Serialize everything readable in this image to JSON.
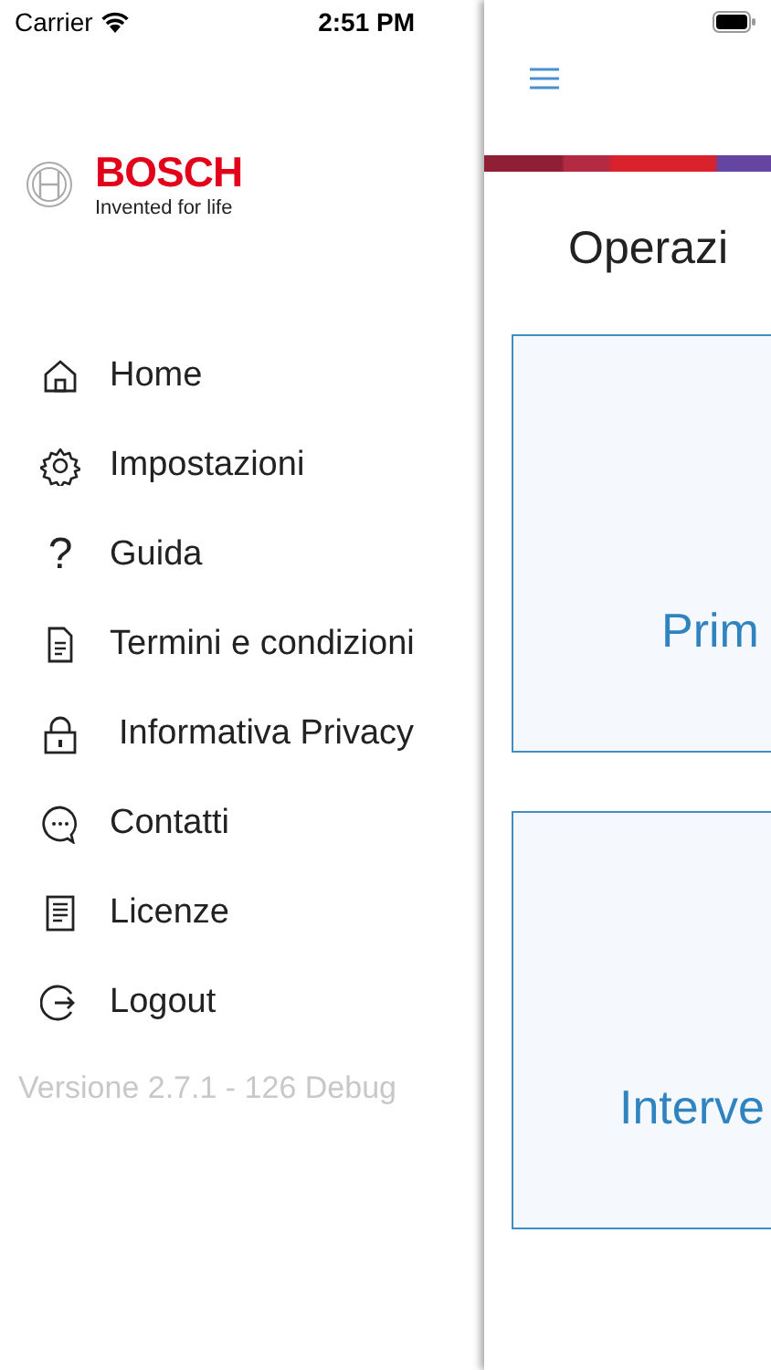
{
  "status_bar": {
    "carrier": "Carrier",
    "time": "2:51 PM"
  },
  "logo": {
    "brand": "BOSCH",
    "tagline": "Invented for life"
  },
  "menu": [
    {
      "label": "Home",
      "kind": "home"
    },
    {
      "label": "Impostazioni",
      "kind": "gear"
    },
    {
      "label": "Guida",
      "kind": "glyph",
      "glyph": "?"
    },
    {
      "label": "Termini e condizioni",
      "kind": "document"
    },
    {
      "label": "Informativa Privacy",
      "kind": "lock"
    },
    {
      "label": "Contatti",
      "kind": "chat"
    },
    {
      "label": "Licenze",
      "kind": "list"
    },
    {
      "label": "Logout",
      "kind": "logout"
    }
  ],
  "version": "Versione 2.7.1 - 126 Debug",
  "main": {
    "title": "Operazi",
    "cards": [
      {
        "label": "Prim"
      },
      {
        "label": "Interve"
      }
    ]
  }
}
